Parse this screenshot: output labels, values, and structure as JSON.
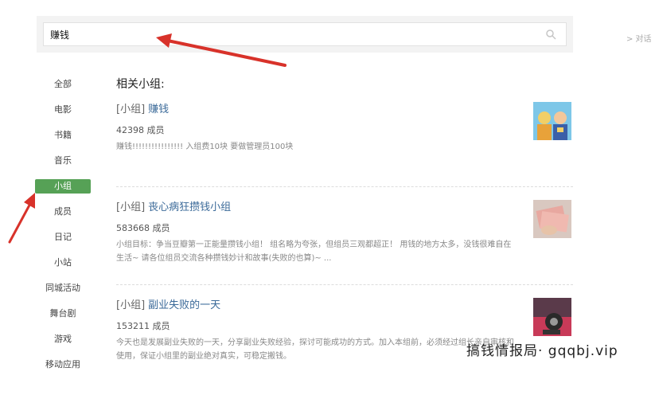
{
  "search": {
    "value": "赚钱"
  },
  "right_link": "> 对话",
  "sidebar": {
    "items": [
      {
        "label": "全部"
      },
      {
        "label": "电影"
      },
      {
        "label": "书籍"
      },
      {
        "label": "音乐"
      },
      {
        "label": "小组",
        "active": true
      },
      {
        "label": "成员"
      },
      {
        "label": "日记"
      },
      {
        "label": "小站"
      },
      {
        "label": "同城活动"
      },
      {
        "label": "舞台剧"
      },
      {
        "label": "游戏"
      },
      {
        "label": "移动应用"
      }
    ]
  },
  "main": {
    "section_title": "相关小组:",
    "results": [
      {
        "tag": "[小组]",
        "name": "赚钱",
        "members": "42398 成员",
        "desc": "赚钱!!!!!!!!!!!!!!!! 入组费10块 要做管理员100块"
      },
      {
        "tag": "[小组]",
        "name": "丧心病狂攒钱小组",
        "members": "583668 成员",
        "desc": "小组目标：争当豆瓣第一正能量攒钱小组！ 组名略为夸张，但组员三观都超正！ 用钱的地方太多，没钱很难自在生活~ 请各位组员交流各种攒钱妙计和故事(失败的也算)~ ..."
      },
      {
        "tag": "[小组]",
        "name": "副业失败的一天",
        "members": "153211 成员",
        "desc": "今天也是发展副业失败的一天，分享副业失败经验，探讨可能成功的方式。加入本组前，必须经过组长亲自审核和使用，保证小组里的副业绝对真实，可稳定搬钱。"
      }
    ]
  },
  "watermark": "搞钱情报局· gqqbj.vip",
  "colors": {
    "accent": "#56a156",
    "link": "#3b6a99",
    "arrow": "#d8322a"
  }
}
